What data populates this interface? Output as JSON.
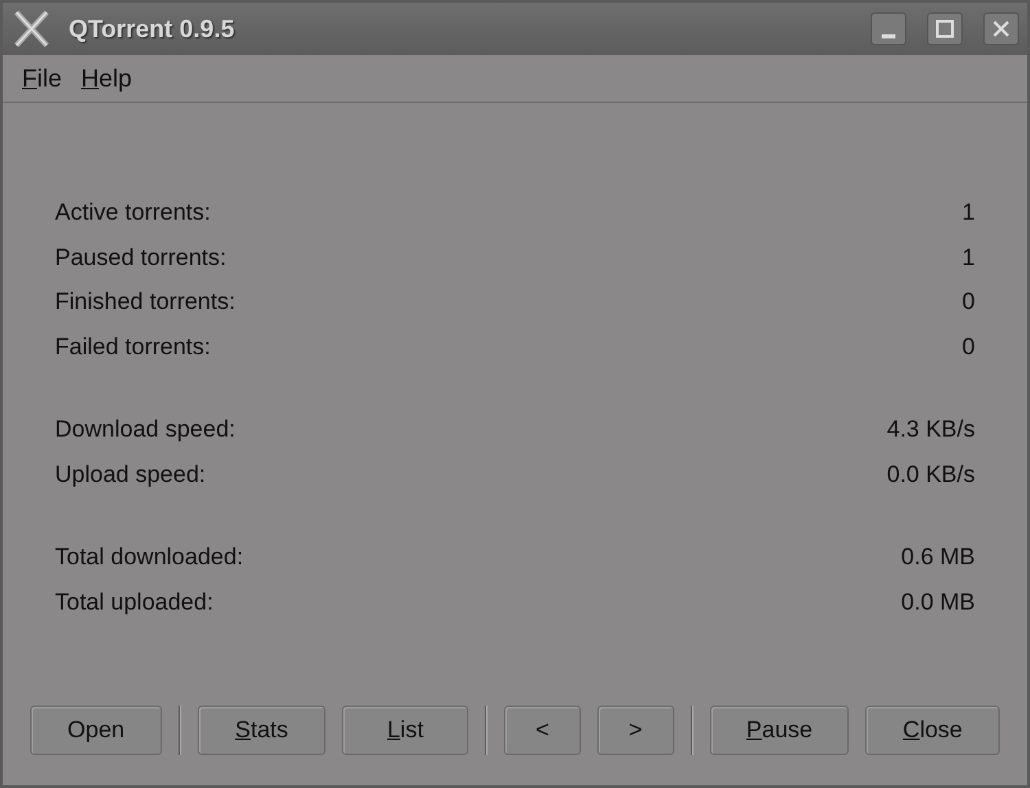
{
  "window": {
    "title": "QTorrent 0.9.5"
  },
  "menu": [
    {
      "key": "F",
      "rest": "ile"
    },
    {
      "key": "H",
      "rest": "elp"
    }
  ],
  "stat_groups": [
    [
      {
        "label": "Active torrents:",
        "value": "1"
      },
      {
        "label": "Paused torrents:",
        "value": "1"
      },
      {
        "label": "Finished torrents:",
        "value": "0"
      },
      {
        "label": "Failed torrents:",
        "value": "0"
      }
    ],
    [
      {
        "label": "Download speed:",
        "value": "4.3 KB/s"
      },
      {
        "label": "Upload speed:",
        "value": "0.0 KB/s"
      }
    ],
    [
      {
        "label": "Total downloaded:",
        "value": "0.6 MB"
      },
      {
        "label": "Total uploaded:",
        "value": "0.0 MB"
      }
    ]
  ],
  "button_groups": [
    [
      {
        "rest": "Open"
      }
    ],
    [
      {
        "key": "S",
        "rest": "tats"
      },
      {
        "key": "L",
        "rest": "ist"
      }
    ],
    [
      {
        "rest": "<"
      },
      {
        "rest": ">"
      }
    ],
    [
      {
        "key": "P",
        "rest": "ause"
      },
      {
        "key": "C",
        "rest": "lose"
      }
    ]
  ]
}
